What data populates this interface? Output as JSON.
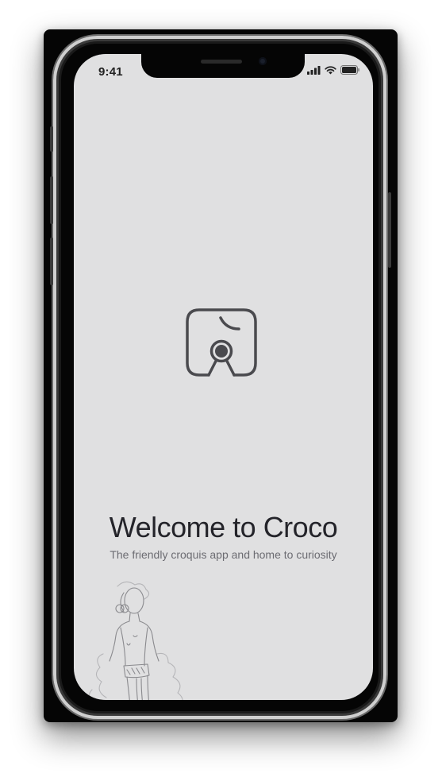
{
  "status_bar": {
    "time": "9:41",
    "icons": [
      "cellular-signal-icon",
      "wifi-icon",
      "battery-icon"
    ]
  },
  "welcome": {
    "logo_icon": "croco-app-logo-icon",
    "title": "Welcome to Croco",
    "subtitle": "The friendly croquis app and home to curiosity"
  },
  "illustration": {
    "name": "croquis-figure-sketch"
  },
  "colors": {
    "screen_background": "#e0e0e1",
    "title_text": "#24242a",
    "subtitle_text": "#6c6c72",
    "logo_stroke": "#4a4a4e",
    "device_frame": "#050505"
  }
}
